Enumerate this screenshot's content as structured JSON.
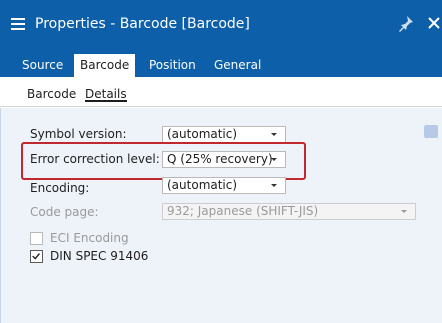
{
  "window": {
    "title": "Properties - Barcode [Barcode]"
  },
  "tabs": [
    {
      "label": "Source",
      "active": false
    },
    {
      "label": "Barcode",
      "active": true
    },
    {
      "label": "Position",
      "active": false
    },
    {
      "label": "General",
      "active": false
    }
  ],
  "subtabs": [
    {
      "label": "Barcode",
      "active": false
    },
    {
      "label": "Details",
      "active": true
    }
  ],
  "fields": {
    "symbol_version": {
      "label": "Symbol version:",
      "value": "(automatic)"
    },
    "error_correction": {
      "label": "Error correction level:",
      "value": "Q (25% recovery)"
    },
    "encoding": {
      "label": "Encoding:",
      "value": "(automatic)"
    },
    "code_page": {
      "label": "Code page:",
      "value": "932; Japanese (SHIFT-JIS)"
    }
  },
  "checkboxes": {
    "eci_encoding": {
      "label": "ECI Encoding",
      "checked": false
    },
    "din_spec": {
      "label": "DIN SPEC 91406",
      "checked": true
    }
  },
  "colors": {
    "title_bar": "#0c5fa8",
    "highlight": "#c0282e",
    "panel": "#eef3fa"
  },
  "icons": {
    "menu": "hamburger-icon",
    "pin": "pin-icon",
    "close": "close-icon",
    "help": "help-icon"
  }
}
